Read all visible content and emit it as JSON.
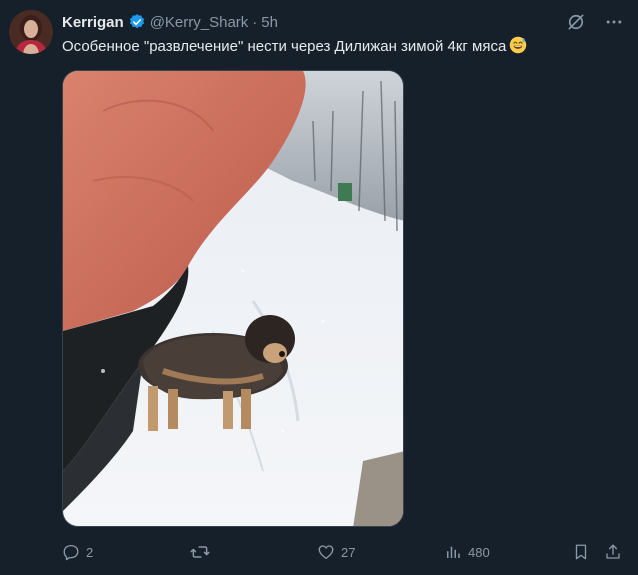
{
  "author": {
    "name": "Kerrigan",
    "handle": "@Kerry_Shark",
    "separator": "·",
    "time": "5h",
    "verified": true
  },
  "tweet": {
    "text": "Особенное \"развлечение\" нести через Дилижан зимой 4кг мяса",
    "emoji": "grinning-sweat-emoji"
  },
  "actions": {
    "replies": "2",
    "retweets": "",
    "likes": "27",
    "views": "480"
  },
  "colors": {
    "background": "#15202b",
    "text": "#e7e9ea",
    "muted": "#8b98a5",
    "verified": "#1d9bf0"
  },
  "icons": [
    "grok-icon",
    "more-icon",
    "reply-icon",
    "retweet-icon",
    "like-icon",
    "views-icon",
    "bookmark-icon",
    "share-icon"
  ]
}
